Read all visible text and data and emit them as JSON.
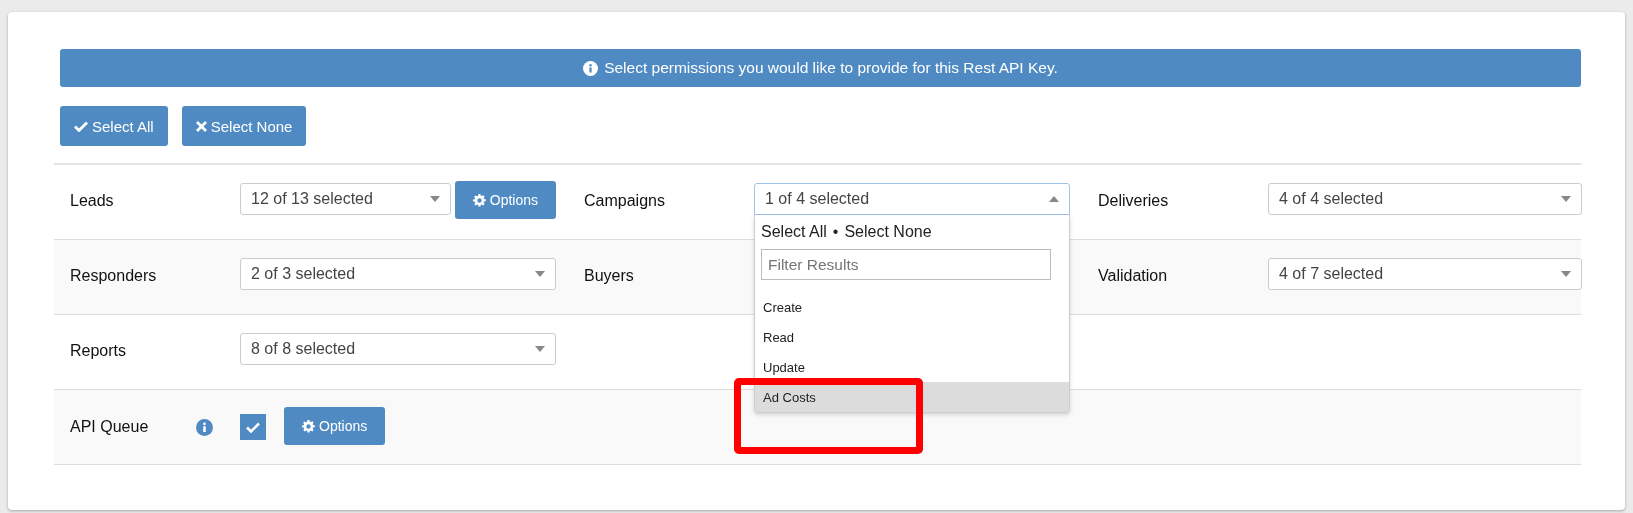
{
  "banner": {
    "text": "Select permissions you would like to provide for this Rest API Key."
  },
  "actions": [
    {
      "kind": "check",
      "label": "Select All"
    },
    {
      "kind": "cross",
      "label": "Select None"
    }
  ],
  "rows": [
    {
      "cells": [
        {
          "label": "Leads",
          "select": {
            "value": "12 of 13 selected",
            "open": false
          },
          "options_button": "Options"
        },
        {
          "label": "Campaigns",
          "select": {
            "value": "1 of 4 selected",
            "open": true
          }
        },
        {
          "label": "Deliveries",
          "select": {
            "value": "4 of 4 selected",
            "open": false
          }
        }
      ]
    },
    {
      "cells": [
        {
          "label": "Responders",
          "select": {
            "value": "2 of 3 selected",
            "open": false
          }
        },
        {
          "label": "Buyers"
        },
        {
          "label": "Validation",
          "select": {
            "value": "4 of 7 selected",
            "open": false
          }
        }
      ]
    },
    {
      "cells": [
        {
          "label": "Reports",
          "select": {
            "value": "8 of 8 selected",
            "open": false
          }
        }
      ]
    },
    {
      "cells": [
        {
          "label": "API Queue",
          "info": true,
          "checkbox": {
            "checked": true
          },
          "options_button": "Options"
        }
      ]
    }
  ],
  "dropdown": {
    "select_all": "Select All",
    "separator": "•",
    "select_none": "Select None",
    "filter_placeholder": "Filter Results",
    "options": [
      {
        "label": "Create",
        "disabled": false,
        "highlighted": false
      },
      {
        "label": "Read",
        "disabled": false,
        "highlighted": false
      },
      {
        "label": "Update",
        "disabled": false,
        "highlighted": false
      },
      {
        "label": "Ad Costs",
        "disabled": false,
        "highlighted": true
      }
    ]
  }
}
